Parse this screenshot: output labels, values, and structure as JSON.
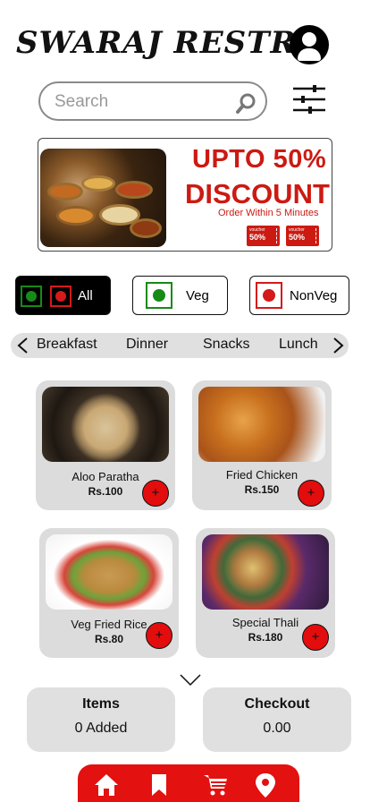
{
  "header": {
    "brand": "SWARAJ RESTRO",
    "profile_icon": "user-icon"
  },
  "search": {
    "placeholder": "Search",
    "value": "",
    "icon": "search-icon",
    "filter_icon": "sliders-icon"
  },
  "banner": {
    "headline": "UPTO 50%",
    "headline2": "DISCOUNT",
    "subtext": "Order Within 5 Minutes",
    "vouchers": [
      {
        "label": "voucher",
        "value": "50%"
      },
      {
        "label": "voucher",
        "value": "50%"
      }
    ]
  },
  "diet_filters": [
    {
      "label": "All",
      "active": true
    },
    {
      "label": "Veg",
      "active": false
    },
    {
      "label": "NonVeg",
      "active": false
    }
  ],
  "categories": [
    "Breakfast",
    "Dinner",
    "Snacks",
    "Lunch"
  ],
  "items": [
    {
      "name": "Aloo Paratha",
      "price": "Rs.100",
      "add": "+"
    },
    {
      "name": "Fried Chicken",
      "price": "Rs.150",
      "add": "+"
    },
    {
      "name": "Veg Fried Rice",
      "price": "Rs.80",
      "add": "+"
    },
    {
      "name": "Special Thali",
      "price": "Rs.180",
      "add": "+"
    }
  ],
  "summary": {
    "items_title": "Items",
    "items_value": "0 Added",
    "checkout_title": "Checkout",
    "checkout_value": "0.00"
  },
  "nav": [
    {
      "icon": "home-icon"
    },
    {
      "icon": "bookmark-icon"
    },
    {
      "icon": "cart-icon"
    },
    {
      "icon": "location-pin-icon"
    }
  ],
  "colors": {
    "accent": "#e3110f",
    "veg": "#178a17",
    "nonveg": "#d41a1a",
    "card": "#dcdcdc"
  }
}
